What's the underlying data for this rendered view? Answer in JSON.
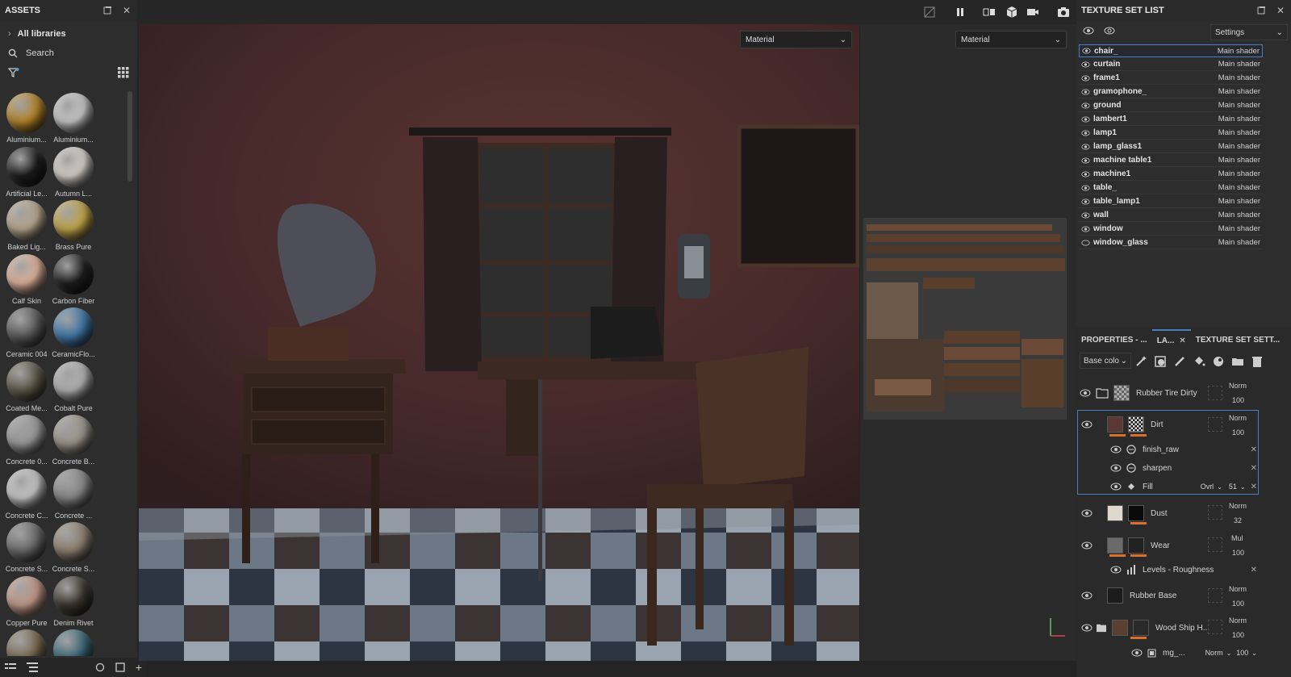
{
  "assets": {
    "title": "ASSETS",
    "all_libraries": "All libraries",
    "search_placeholder": "Search",
    "items": [
      {
        "label": "Aluminium...",
        "color": "#b7862a",
        "col": 0,
        "row": 0
      },
      {
        "label": "Aluminium...",
        "color": "#c9c9c9",
        "col": 1,
        "row": 0
      },
      {
        "label": "Artificial Le...",
        "color": "#1c1c1c",
        "col": 0,
        "row": 1
      },
      {
        "label": "Autumn L...",
        "color": "#d8d2cc",
        "col": 1,
        "row": 1
      },
      {
        "label": "Baked Lig...",
        "color": "#b9a88f",
        "col": 0,
        "row": 2
      },
      {
        "label": "Brass Pure",
        "color": "#c5a74a",
        "col": 1,
        "row": 2
      },
      {
        "label": "Calf Skin",
        "color": "#e1b49d",
        "col": 0,
        "row": 3
      },
      {
        "label": "Carbon Fiber",
        "color": "#1e1e1e",
        "col": 1,
        "row": 3
      },
      {
        "label": "Ceramic 004",
        "color": "#5a5a5a",
        "col": 0,
        "row": 4
      },
      {
        "label": "CeramicFlo...",
        "color": "#3f78a8",
        "col": 1,
        "row": 4
      },
      {
        "label": "Coated Me...",
        "color": "#5c5748",
        "col": 0,
        "row": 5
      },
      {
        "label": "Cobalt Pure",
        "color": "#b3b3b3",
        "col": 1,
        "row": 5
      },
      {
        "label": "Concrete 0...",
        "color": "#9a9a9a",
        "col": 0,
        "row": 6
      },
      {
        "label": "Concrete B...",
        "color": "#9c968c",
        "col": 1,
        "row": 6
      },
      {
        "label": "Concrete C...",
        "color": "#c8c8c8",
        "col": 0,
        "row": 7
      },
      {
        "label": "Concrete ...",
        "color": "#888888",
        "col": 1,
        "row": 7
      },
      {
        "label": "Concrete S...",
        "color": "#6a6a6a",
        "col": 0,
        "row": 8
      },
      {
        "label": "Concrete S...",
        "color": "#8e8070",
        "col": 1,
        "row": 8
      },
      {
        "label": "Copper Pure",
        "color": "#c49a88",
        "col": 0,
        "row": 9
      },
      {
        "label": "Denim Rivet",
        "color": "#3a342c",
        "col": 1,
        "row": 9
      },
      {
        "label": "",
        "color": "#7a6a50",
        "col": 0,
        "row": 10
      },
      {
        "label": "",
        "color": "#3a6878",
        "col": 1,
        "row": 10
      }
    ]
  },
  "viewport": {
    "material_left": "Material",
    "material_right": "Material"
  },
  "texture_set_list": {
    "title": "TEXTURE SET LIST",
    "settings": "Settings",
    "items": [
      {
        "name": "chair_",
        "shader": "Main shader"
      },
      {
        "name": "curtain",
        "shader": "Main shader"
      },
      {
        "name": "frame1",
        "shader": "Main shader"
      },
      {
        "name": "gramophone_",
        "shader": "Main shader"
      },
      {
        "name": "ground",
        "shader": "Main shader"
      },
      {
        "name": "lambert1",
        "shader": "Main shader"
      },
      {
        "name": "lamp1",
        "shader": "Main shader"
      },
      {
        "name": "lamp_glass1",
        "shader": "Main shader"
      },
      {
        "name": "machine table1",
        "shader": "Main shader"
      },
      {
        "name": "machine1",
        "shader": "Main shader"
      },
      {
        "name": "table_",
        "shader": "Main shader"
      },
      {
        "name": "table_lamp1",
        "shader": "Main shader"
      },
      {
        "name": "wall",
        "shader": "Main shader"
      },
      {
        "name": "window",
        "shader": "Main shader"
      },
      {
        "name": "window_glass",
        "shader": "Main shader"
      }
    ]
  },
  "layers_panel": {
    "tab_properties": "PROPERTIES - ...",
    "tab_layers": "LA...",
    "tab_texture_set_settings": "TEXTURE SET SETT...",
    "channel": "Base colo",
    "layers": {
      "rubber_tire_dirty": {
        "name": "Rubber Tire Dirty",
        "blend": "Norm",
        "opacity": "100"
      },
      "dirt": {
        "name": "Dirt",
        "blend": "Norm",
        "opacity": "100"
      },
      "finish_raw": {
        "name": "finish_raw"
      },
      "sharpen": {
        "name": "sharpen"
      },
      "fill": {
        "name": "Fill",
        "blend": "Ovrl",
        "opacity": "51"
      },
      "dust": {
        "name": "Dust",
        "blend": "Norm",
        "opacity": "32"
      },
      "wear": {
        "name": "Wear",
        "blend": "Mul",
        "opacity": "100"
      },
      "levels_roughness": {
        "name": "Levels - Roughness"
      },
      "rubber_base": {
        "name": "Rubber Base",
        "blend": "Norm",
        "opacity": "100"
      },
      "wood_ship": {
        "name": "Wood Ship H...",
        "blend": "Norm",
        "opacity": "100"
      },
      "mg": {
        "name": "mg_...",
        "blend": "Norm",
        "opacity": "100"
      }
    }
  },
  "colors": {
    "accent": "#d7702a",
    "selection": "#4a7fc1"
  }
}
